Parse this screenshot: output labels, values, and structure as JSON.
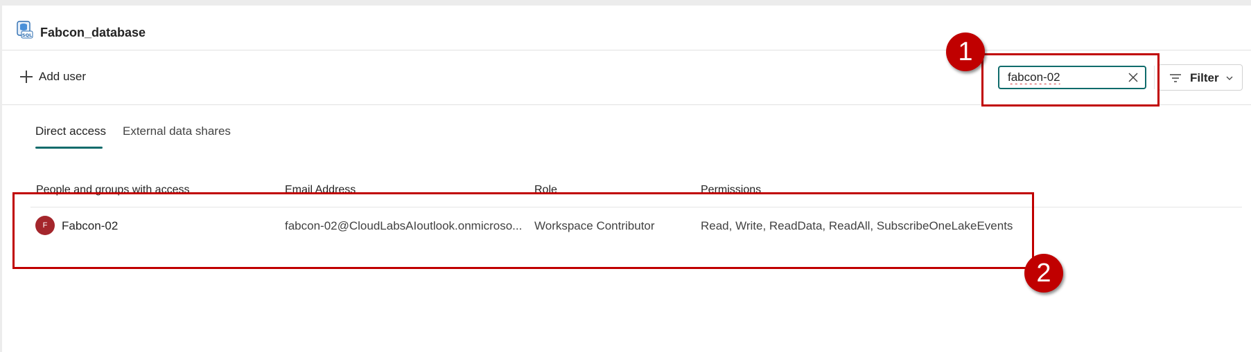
{
  "header": {
    "db_icon": "sql-database-icon",
    "title": "Fabcon_database"
  },
  "toolbar": {
    "add_user_label": "Add user",
    "search": {
      "value": "fabcon-02",
      "clear_icon": "close-icon"
    },
    "filter_label": "Filter"
  },
  "tabs": [
    {
      "label": "Direct access",
      "selected": true
    },
    {
      "label": "External data shares",
      "selected": false
    }
  ],
  "table": {
    "columns": [
      "People and groups with access",
      "Email Address",
      "Role",
      "Permissions"
    ],
    "rows": [
      {
        "avatar_initial": "F",
        "name": "Fabcon-02",
        "email": "fabcon-02@CloudLabsAIoutlook.onmicroso...",
        "role": "Workspace Contributor",
        "permissions": "Read, Write, ReadData, ReadAll, SubscribeOneLakeEvents"
      }
    ]
  },
  "annotations": {
    "badge_1": "1",
    "badge_2": "2",
    "color": "#c00000"
  },
  "colors": {
    "accent": "#0f6b6b",
    "avatar": "#a4262c"
  }
}
